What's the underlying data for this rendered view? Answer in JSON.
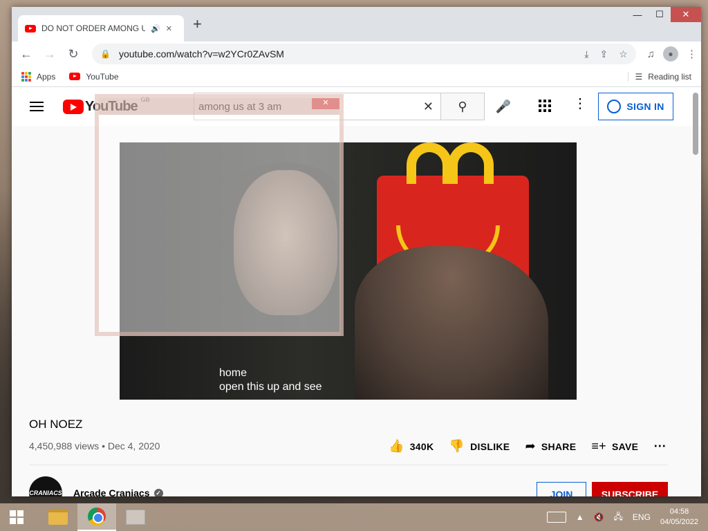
{
  "browser": {
    "tab_title": "DO NOT ORDER AMONG US",
    "tab_audio_icon": "speaker-icon",
    "tab_close": "✕",
    "new_tab": "+",
    "url": "youtube.com/watch?v=w2YCr0ZAvSM",
    "window_controls": {
      "minimize": "—",
      "maximize": "☐",
      "close": "✕"
    }
  },
  "bookmarks": {
    "apps_label": "Apps",
    "youtube_label": "YouTube",
    "reading_list_label": "Reading list"
  },
  "youtube": {
    "region": "GB",
    "search_value": "among us at 3 am",
    "sign_in_label": "SIGN IN",
    "video": {
      "caption_line1": "home",
      "caption_line2": "open this up and see"
    },
    "title": "OH NOEZ",
    "meta": "4,450,988 views • Dec 4, 2020",
    "actions": {
      "likes": "340K",
      "dislike": "DISLIKE",
      "share": "SHARE",
      "save": "SAVE",
      "more": "⋯"
    },
    "channel": {
      "name": "Arcade Craniacs",
      "avatar_text": "CRANIACS",
      "join_label": "JOIN",
      "subscribe_label": "SUBSCRIBE"
    }
  },
  "taskbar": {
    "language": "ENG",
    "time": "04:58",
    "date": "04/05/2022"
  }
}
